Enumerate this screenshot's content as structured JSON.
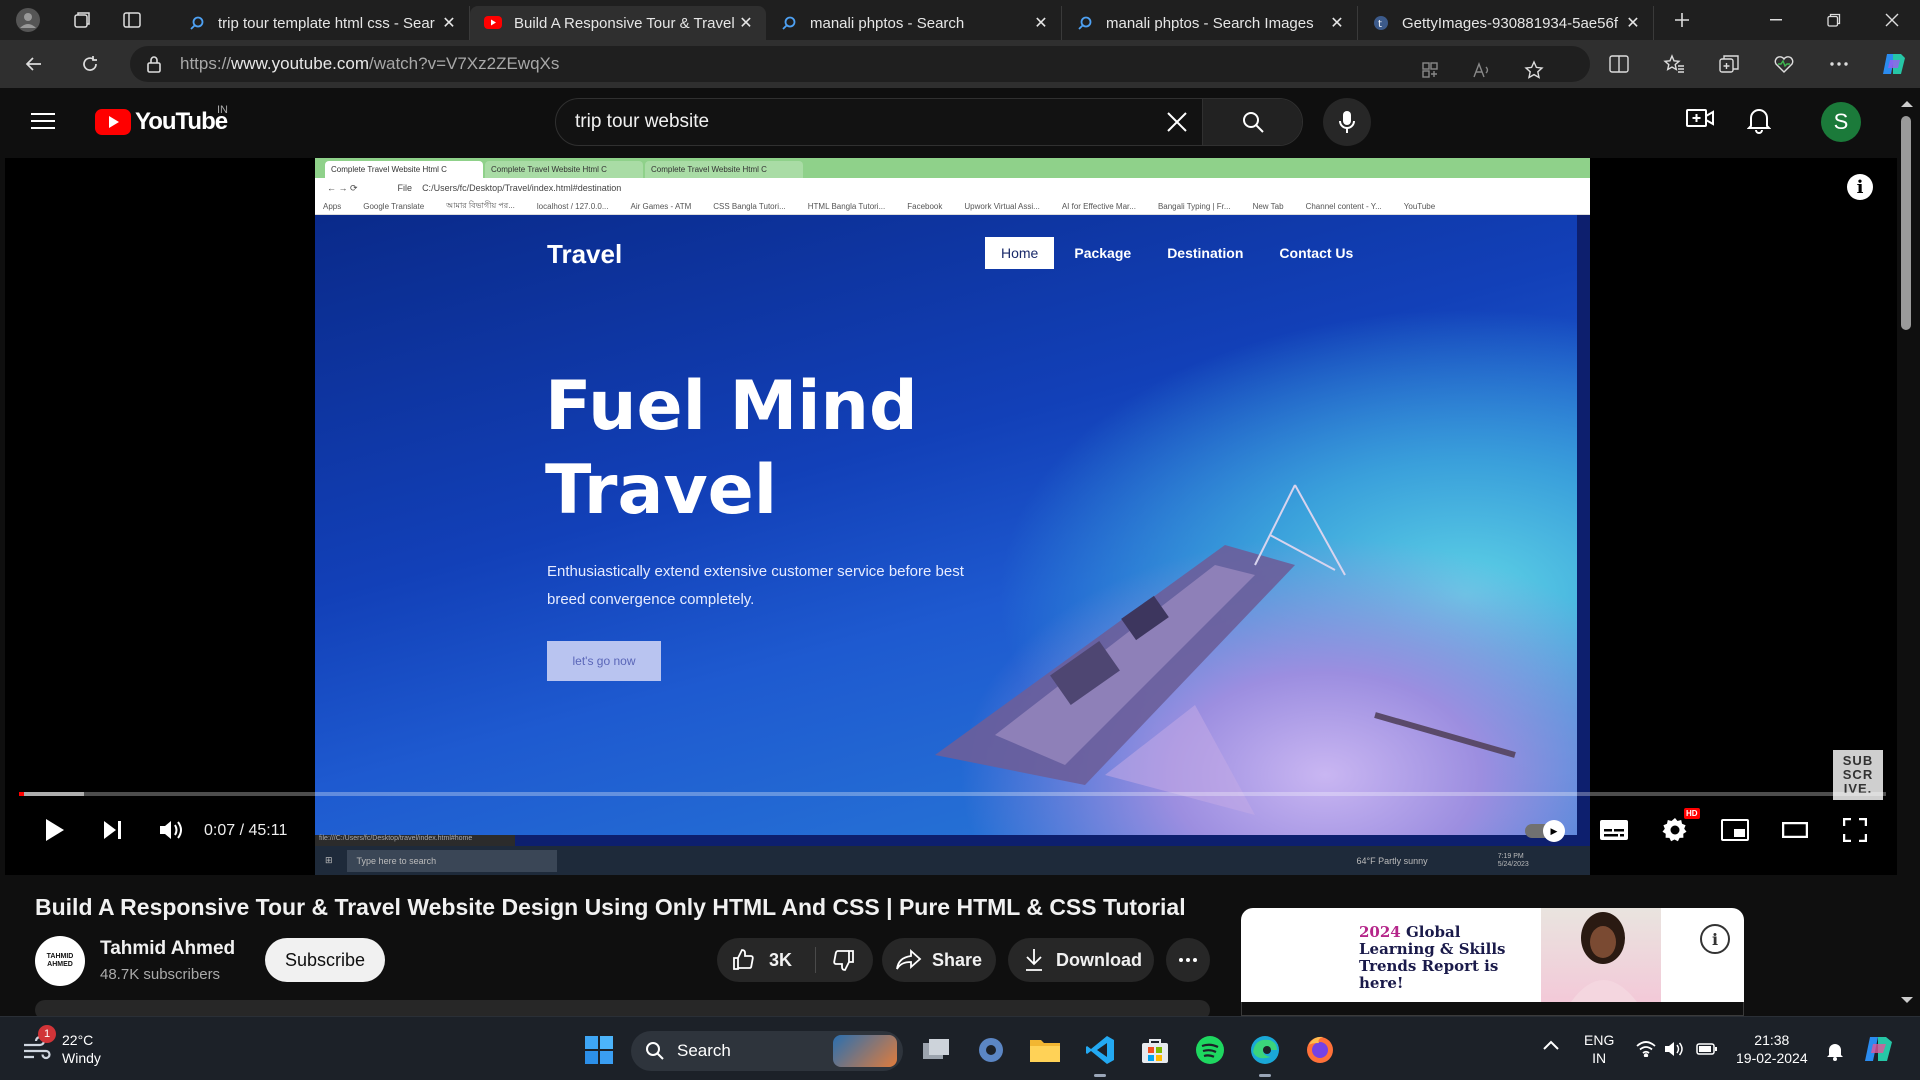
{
  "browser": {
    "tabs": [
      {
        "title": "trip tour template html css - Sear",
        "icon": "search-icon",
        "active": false
      },
      {
        "title": "Build A Responsive Tour & Travel",
        "icon": "youtube-icon",
        "active": true
      },
      {
        "title": "manali phptos - Search",
        "icon": "search-icon",
        "active": false
      },
      {
        "title": "manali phptos - Search Images",
        "icon": "search-icon",
        "active": false
      },
      {
        "title": "GettyImages-930881934-5ae56f",
        "icon": "image-icon",
        "active": false
      }
    ],
    "url_prefix": "https://",
    "url_host": "www.youtube.com",
    "url_path": "/watch?v=V7Xz2ZEwqXs"
  },
  "youtube": {
    "logo_text": "YouTube",
    "country_code": "IN",
    "search_value": "trip tour website",
    "avatar_letter": "S",
    "player": {
      "time_current": "0:07",
      "time_total": "45:11",
      "progress_fraction": 0.0026,
      "buffered_fraction": 0.035,
      "subscribe_watermark": "SUB SCR IVE.",
      "hd_badge": "HD",
      "info": "i"
    },
    "recorded": {
      "tab1": "Complete Travel Website Html C",
      "tab2": "Complete Travel Website Html C",
      "tab3": "Complete Travel Website Html C",
      "file_label": "File",
      "url": "C:/Users/fc/Desktop/Travel/index.html#destination",
      "bookmarks": [
        "Apps",
        "Google Translate",
        "আমার বিভাগীয় পর...",
        "localhost / 127.0.0...",
        "Air Games - ATM",
        "CSS Bangla Tutori...",
        "HTML Bangla Tutori...",
        "Facebook",
        "Upwork Virtual Assi...",
        "AI for Effective Mar...",
        "Bangali Typing | Fr...",
        "New Tab",
        "Channel content - Y...",
        "YouTube"
      ],
      "brand": "Travel",
      "nav": [
        "Home",
        "Package",
        "Destination",
        "Contact Us"
      ],
      "hero_line1": "Fuel Mind",
      "hero_line2": "Travel",
      "sub": "Enthusiastically extend extensive customer service before best breed convergence completely.",
      "cta": "let's go now",
      "status_url": "file:///C:/Users/fc/Desktop/travel/index.html#home",
      "taskbar_search": "Type here to search",
      "weather": "64°F  Partly sunny",
      "clock_time": "7:19 PM",
      "clock_date": "5/24/2023"
    },
    "video_title": "Build A Responsive Tour & Travel Website Design Using Only HTML And CSS | Pure HTML & CSS Tutorial",
    "channel": {
      "avatar_text": "TAHMID AHMED",
      "name": "Tahmid Ahmed",
      "subscribers": "48.7K subscribers",
      "subscribe_label": "Subscribe"
    },
    "actions": {
      "likes": "3K",
      "share": "Share",
      "download": "Download"
    },
    "ad": {
      "year": "2024",
      "text": " Global Learning & Skills Trends Report is here!"
    }
  },
  "taskbar": {
    "weather_badge": "1",
    "temperature": "22°C",
    "condition": "Windy",
    "search_label": "Search",
    "language": "ENG",
    "region": "IN",
    "time": "21:38",
    "date": "19-02-2024"
  }
}
